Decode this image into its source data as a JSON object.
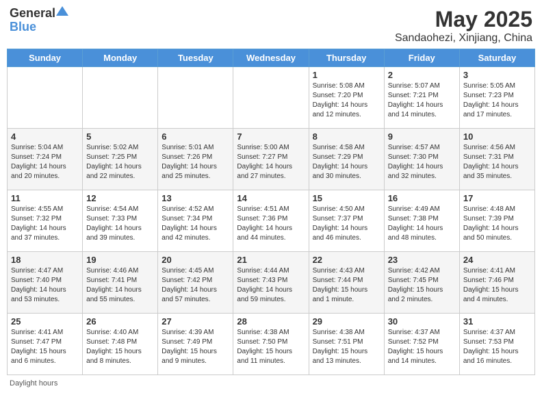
{
  "logo": {
    "general": "General",
    "blue": "Blue"
  },
  "title": "May 2025",
  "location": "Sandaohezi, Xinjiang, China",
  "days_of_week": [
    "Sunday",
    "Monday",
    "Tuesday",
    "Wednesday",
    "Thursday",
    "Friday",
    "Saturday"
  ],
  "footer_note": "Daylight hours",
  "weeks": [
    [
      {
        "day": "",
        "sunrise": "",
        "sunset": "",
        "daylight": ""
      },
      {
        "day": "",
        "sunrise": "",
        "sunset": "",
        "daylight": ""
      },
      {
        "day": "",
        "sunrise": "",
        "sunset": "",
        "daylight": ""
      },
      {
        "day": "",
        "sunrise": "",
        "sunset": "",
        "daylight": ""
      },
      {
        "day": "1",
        "sunrise": "Sunrise: 5:08 AM",
        "sunset": "Sunset: 7:20 PM",
        "daylight": "Daylight: 14 hours and 12 minutes."
      },
      {
        "day": "2",
        "sunrise": "Sunrise: 5:07 AM",
        "sunset": "Sunset: 7:21 PM",
        "daylight": "Daylight: 14 hours and 14 minutes."
      },
      {
        "day": "3",
        "sunrise": "Sunrise: 5:05 AM",
        "sunset": "Sunset: 7:23 PM",
        "daylight": "Daylight: 14 hours and 17 minutes."
      }
    ],
    [
      {
        "day": "4",
        "sunrise": "Sunrise: 5:04 AM",
        "sunset": "Sunset: 7:24 PM",
        "daylight": "Daylight: 14 hours and 20 minutes."
      },
      {
        "day": "5",
        "sunrise": "Sunrise: 5:02 AM",
        "sunset": "Sunset: 7:25 PM",
        "daylight": "Daylight: 14 hours and 22 minutes."
      },
      {
        "day": "6",
        "sunrise": "Sunrise: 5:01 AM",
        "sunset": "Sunset: 7:26 PM",
        "daylight": "Daylight: 14 hours and 25 minutes."
      },
      {
        "day": "7",
        "sunrise": "Sunrise: 5:00 AM",
        "sunset": "Sunset: 7:27 PM",
        "daylight": "Daylight: 14 hours and 27 minutes."
      },
      {
        "day": "8",
        "sunrise": "Sunrise: 4:58 AM",
        "sunset": "Sunset: 7:29 PM",
        "daylight": "Daylight: 14 hours and 30 minutes."
      },
      {
        "day": "9",
        "sunrise": "Sunrise: 4:57 AM",
        "sunset": "Sunset: 7:30 PM",
        "daylight": "Daylight: 14 hours and 32 minutes."
      },
      {
        "day": "10",
        "sunrise": "Sunrise: 4:56 AM",
        "sunset": "Sunset: 7:31 PM",
        "daylight": "Daylight: 14 hours and 35 minutes."
      }
    ],
    [
      {
        "day": "11",
        "sunrise": "Sunrise: 4:55 AM",
        "sunset": "Sunset: 7:32 PM",
        "daylight": "Daylight: 14 hours and 37 minutes."
      },
      {
        "day": "12",
        "sunrise": "Sunrise: 4:54 AM",
        "sunset": "Sunset: 7:33 PM",
        "daylight": "Daylight: 14 hours and 39 minutes."
      },
      {
        "day": "13",
        "sunrise": "Sunrise: 4:52 AM",
        "sunset": "Sunset: 7:34 PM",
        "daylight": "Daylight: 14 hours and 42 minutes."
      },
      {
        "day": "14",
        "sunrise": "Sunrise: 4:51 AM",
        "sunset": "Sunset: 7:36 PM",
        "daylight": "Daylight: 14 hours and 44 minutes."
      },
      {
        "day": "15",
        "sunrise": "Sunrise: 4:50 AM",
        "sunset": "Sunset: 7:37 PM",
        "daylight": "Daylight: 14 hours and 46 minutes."
      },
      {
        "day": "16",
        "sunrise": "Sunrise: 4:49 AM",
        "sunset": "Sunset: 7:38 PM",
        "daylight": "Daylight: 14 hours and 48 minutes."
      },
      {
        "day": "17",
        "sunrise": "Sunrise: 4:48 AM",
        "sunset": "Sunset: 7:39 PM",
        "daylight": "Daylight: 14 hours and 50 minutes."
      }
    ],
    [
      {
        "day": "18",
        "sunrise": "Sunrise: 4:47 AM",
        "sunset": "Sunset: 7:40 PM",
        "daylight": "Daylight: 14 hours and 53 minutes."
      },
      {
        "day": "19",
        "sunrise": "Sunrise: 4:46 AM",
        "sunset": "Sunset: 7:41 PM",
        "daylight": "Daylight: 14 hours and 55 minutes."
      },
      {
        "day": "20",
        "sunrise": "Sunrise: 4:45 AM",
        "sunset": "Sunset: 7:42 PM",
        "daylight": "Daylight: 14 hours and 57 minutes."
      },
      {
        "day": "21",
        "sunrise": "Sunrise: 4:44 AM",
        "sunset": "Sunset: 7:43 PM",
        "daylight": "Daylight: 14 hours and 59 minutes."
      },
      {
        "day": "22",
        "sunrise": "Sunrise: 4:43 AM",
        "sunset": "Sunset: 7:44 PM",
        "daylight": "Daylight: 15 hours and 1 minute."
      },
      {
        "day": "23",
        "sunrise": "Sunrise: 4:42 AM",
        "sunset": "Sunset: 7:45 PM",
        "daylight": "Daylight: 15 hours and 2 minutes."
      },
      {
        "day": "24",
        "sunrise": "Sunrise: 4:41 AM",
        "sunset": "Sunset: 7:46 PM",
        "daylight": "Daylight: 15 hours and 4 minutes."
      }
    ],
    [
      {
        "day": "25",
        "sunrise": "Sunrise: 4:41 AM",
        "sunset": "Sunset: 7:47 PM",
        "daylight": "Daylight: 15 hours and 6 minutes."
      },
      {
        "day": "26",
        "sunrise": "Sunrise: 4:40 AM",
        "sunset": "Sunset: 7:48 PM",
        "daylight": "Daylight: 15 hours and 8 minutes."
      },
      {
        "day": "27",
        "sunrise": "Sunrise: 4:39 AM",
        "sunset": "Sunset: 7:49 PM",
        "daylight": "Daylight: 15 hours and 9 minutes."
      },
      {
        "day": "28",
        "sunrise": "Sunrise: 4:38 AM",
        "sunset": "Sunset: 7:50 PM",
        "daylight": "Daylight: 15 hours and 11 minutes."
      },
      {
        "day": "29",
        "sunrise": "Sunrise: 4:38 AM",
        "sunset": "Sunset: 7:51 PM",
        "daylight": "Daylight: 15 hours and 13 minutes."
      },
      {
        "day": "30",
        "sunrise": "Sunrise: 4:37 AM",
        "sunset": "Sunset: 7:52 PM",
        "daylight": "Daylight: 15 hours and 14 minutes."
      },
      {
        "day": "31",
        "sunrise": "Sunrise: 4:37 AM",
        "sunset": "Sunset: 7:53 PM",
        "daylight": "Daylight: 15 hours and 16 minutes."
      }
    ]
  ]
}
